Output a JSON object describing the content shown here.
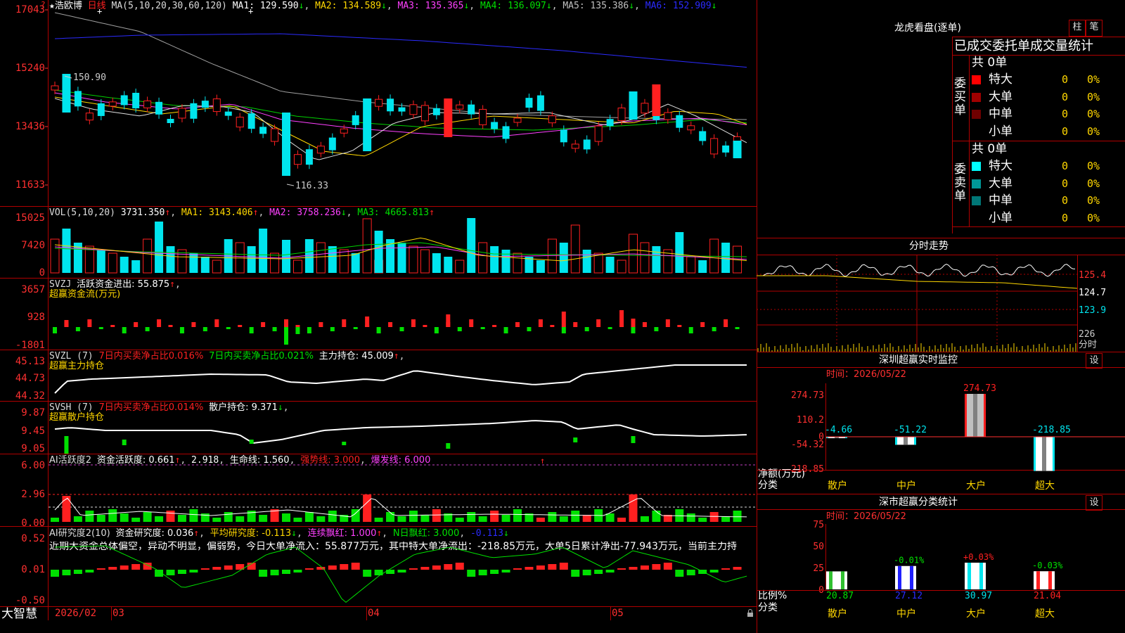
{
  "app": {
    "logo_text": "大智慧",
    "star": "★",
    "stock_name": "浩欧博",
    "period": "日线"
  },
  "colors": {
    "up": "#ff2020",
    "down": "#00e5ee",
    "ma1": "#e0e0e0",
    "ma2": "#ffd700",
    "ma3": "#ff40ff",
    "ma4": "#00d000",
    "ma5": "#a0a0a0",
    "ma6": "#2b2bff",
    "axis": "#ff3030",
    "grid": "#b00000"
  },
  "main": {
    "indicator_name": "MA(5,10,20,30,60,120)",
    "ma1": "MA1: 129.590",
    "ma2": "MA2: 134.589",
    "ma3": "MA3: 135.365",
    "ma4": "MA4: 136.097",
    "ma5": "MA5: 135.386",
    "ma6": "MA6: 152.909",
    "high_label": "150.90",
    "low_label": "116.33",
    "y_ticks": [
      "17043",
      "15240",
      "13436",
      "11633"
    ],
    "x_ticks": [
      "2026/02",
      "03",
      "04",
      "05"
    ]
  },
  "vol": {
    "name": "VOL(5,10,20)",
    "value": "3731.350",
    "ma1": "MA1: 3143.406",
    "ma2": "MA2: 3758.236",
    "ma3": "MA3: 4665.813",
    "y_ticks": [
      "15025",
      "7420",
      "0"
    ]
  },
  "svzj": {
    "name": "SVZJ",
    "label": "活跃资金进出: 55.875",
    "sub_label": "超赢资金流(万元)",
    "y_ticks": [
      "3657",
      "928",
      "-1801"
    ]
  },
  "svzl": {
    "name": "SVZL (7)",
    "label1": "7日内买卖净占比0.016%",
    "label2": "7日内买卖净占比0.021%",
    "label3": "主力持仓: 45.009",
    "sub_label": "超赢主力持仓",
    "y_ticks": [
      "45.13",
      "44.73",
      "44.32"
    ]
  },
  "svsh": {
    "name": "SVSH (7)",
    "label1": "7日内买卖净占比0.014%",
    "label2": "散户持仓: 9.371",
    "sub_label": "超赢散户持仓",
    "y_ticks": [
      "9.87",
      "9.45",
      "9.05"
    ]
  },
  "ai_active": {
    "name": "AI活跃度2",
    "label1": "资金活跃度: 0.661",
    "label2": "2.918",
    "label3": "生命线: 1.560",
    "label4": "强势线: 3.000",
    "label5": "爆发线: 6.000",
    "y_ticks": [
      "6.00",
      "2.96",
      "0.00"
    ]
  },
  "ai_research": {
    "name": "AI研究度2(10)",
    "label1": "资金研究度: 0.036",
    "label2": "平均研究度: -0.113",
    "label3": "连续飘红: 1.000",
    "label4": "N日飘红: 3.000",
    "label5": "-0.113",
    "commentary": "近期大资金总体偏空，异动不明显，偏弱势，今日大单净流入：55.877万元，其中特大单净流出：-218.85万元，大单5日累计净出-77.943万元，当前主力持",
    "y_ticks": [
      "0.52",
      "0.01",
      "-0.50"
    ]
  },
  "longhu": {
    "title": "龙虎看盘(逐单)",
    "btn_bar": "柱",
    "btn_pen": "笔",
    "tabs": [
      "已成交",
      "委托单",
      "成交量统计"
    ],
    "buy_side": "委买单",
    "sell_side": "委卖单",
    "buy_total": "共 0单",
    "sell_total": "共 0单",
    "buy_rows": [
      {
        "label": "特大",
        "count": "0",
        "pct": "0%",
        "color": "#ff0000"
      },
      {
        "label": "大单",
        "count": "0",
        "pct": "0%",
        "color": "#a00000"
      },
      {
        "label": "中单",
        "count": "0",
        "pct": "0%",
        "color": "#700000"
      },
      {
        "label": "小单",
        "count": "0",
        "pct": "0%",
        "color": "#000000"
      }
    ],
    "sell_rows": [
      {
        "label": "特大",
        "count": "0",
        "pct": "0%",
        "color": "#00ffff"
      },
      {
        "label": "大单",
        "count": "0",
        "pct": "0%",
        "color": "#009999"
      },
      {
        "label": "中单",
        "count": "0",
        "pct": "0%",
        "color": "#007777"
      },
      {
        "label": "小单",
        "count": "0",
        "pct": "0%",
        "color": "#000000"
      }
    ]
  },
  "intraday": {
    "title": "分时走势",
    "y_ticks": [
      "125.4",
      "124.7",
      "123.9"
    ],
    "vol_tick": "226",
    "vol_label": "分时"
  },
  "sz_monitor": {
    "title": "深圳超赢实时监控",
    "btn": "设",
    "time": "时间：2026/05/22",
    "y_ticks": [
      "274.73",
      "110.2",
      "0",
      "-54.32",
      "-218.85"
    ],
    "axis_label1": "净额(万元)",
    "axis_label2": "分类",
    "categories": [
      "散户",
      "中户",
      "大户",
      "超大"
    ],
    "values": [
      -4.66,
      -51.22,
      274.73,
      -218.85
    ],
    "value_labels": [
      "-4.66",
      "-51.22",
      "274.73",
      "-218.85"
    ]
  },
  "sz_class": {
    "title": "深市超赢分类统计",
    "btn": "设",
    "time": "时间：2026/05/22",
    "y_ticks": [
      "75",
      "50",
      "25",
      "0"
    ],
    "axis_label1": "比例%",
    "axis_label2": "分类",
    "categories": [
      "散户",
      "中户",
      "大户",
      "超大"
    ],
    "values": [
      20.87,
      27.12,
      30.97,
      21.04
    ],
    "change_labels": [
      "",
      "-0.01%",
      "+0.03%",
      "-0.03%"
    ],
    "bar_colors": [
      "#30c030",
      "#2020ff",
      "#00e5ee",
      "#ff2020"
    ]
  },
  "chart_data": [
    {
      "type": "candlestick",
      "title": "日线",
      "ylim": [
        11633,
        17043
      ],
      "x_ticks": [
        "2026/02",
        "03",
        "04",
        "05"
      ],
      "high": 150.9,
      "low": 116.33
    },
    {
      "type": "bar",
      "title": "深圳超赢实时监控",
      "categories": [
        "散户",
        "中户",
        "大户",
        "超大"
      ],
      "values": [
        -4.66,
        -51.22,
        274.73,
        -218.85
      ],
      "ylim": [
        -218.85,
        274.73
      ],
      "ylabel": "净额(万元)",
      "xlabel": "分类"
    },
    {
      "type": "bar",
      "title": "深市超赢分类统计",
      "categories": [
        "散户",
        "中户",
        "大户",
        "超大"
      ],
      "values": [
        20.87,
        27.12,
        30.97,
        21.04
      ],
      "ylim": [
        0,
        75
      ],
      "ylabel": "比例%",
      "xlabel": "分类"
    }
  ]
}
